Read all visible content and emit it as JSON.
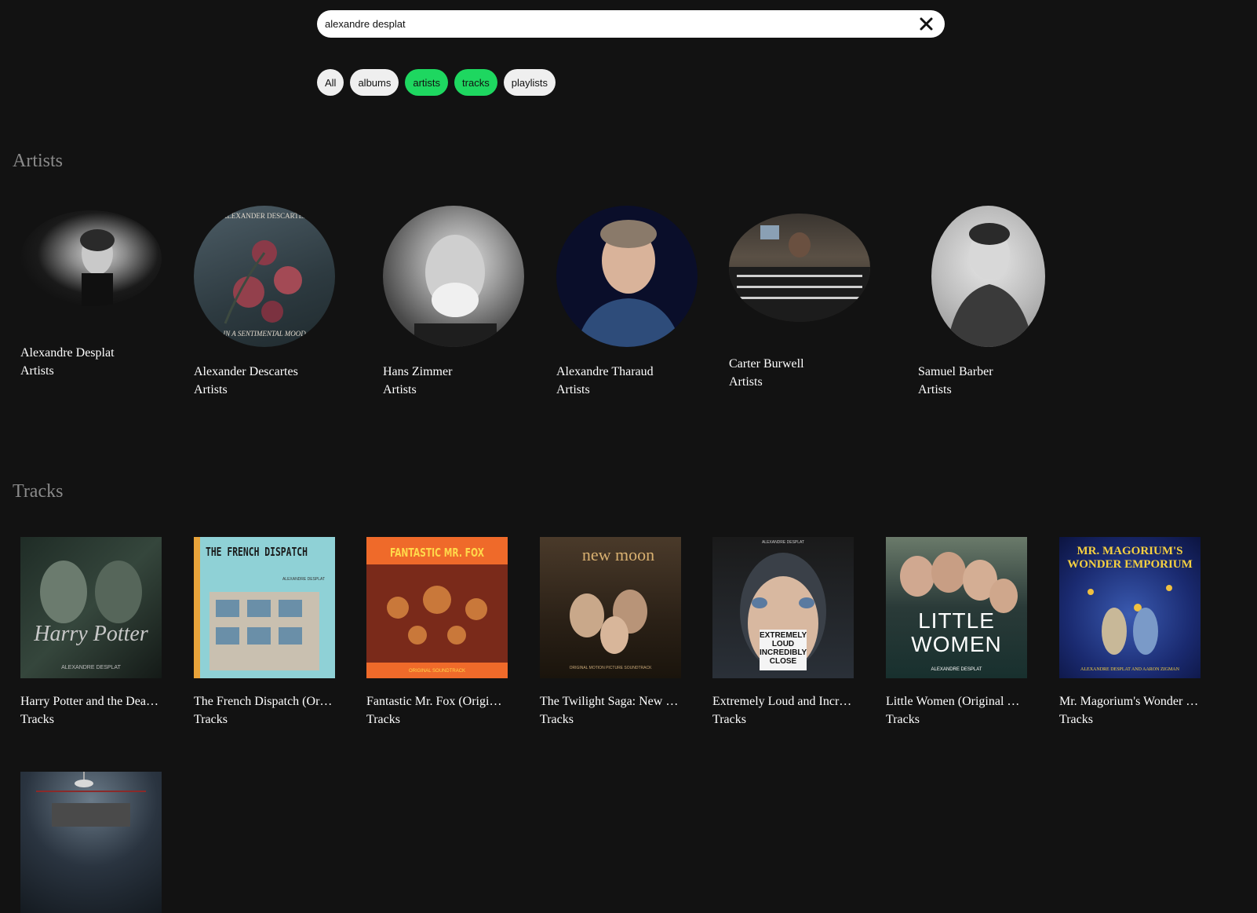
{
  "search": {
    "value": "alexandre desplat",
    "clear_icon": "close-icon"
  },
  "filters": [
    {
      "label": "All",
      "active": false
    },
    {
      "label": "albums",
      "active": false
    },
    {
      "label": "artists",
      "active": true
    },
    {
      "label": "tracks",
      "active": true
    },
    {
      "label": "playlists",
      "active": false
    }
  ],
  "colors": {
    "accent": "#1ed760",
    "background": "#121212",
    "section_title": "#8a8a8a"
  },
  "artists": {
    "title": "Artists",
    "items": [
      {
        "name": "Alexandre Desplat",
        "type": "Artists"
      },
      {
        "name": "Alexander Descartes",
        "type": "Artists",
        "art_text_top": "ALEXANDER DESCARTES",
        "art_text_bottom": "IN A SENTIMENTAL MOOD"
      },
      {
        "name": "Hans Zimmer",
        "type": "Artists"
      },
      {
        "name": "Alexandre Tharaud",
        "type": "Artists"
      },
      {
        "name": "Carter Burwell",
        "type": "Artists"
      },
      {
        "name": "Samuel Barber",
        "type": "Artists"
      }
    ]
  },
  "tracks": {
    "title": "Tracks",
    "items": [
      {
        "name": "Harry Potter and the Deathly Hallows",
        "type": "Tracks",
        "art_text": "Harry Potter",
        "art_sub": "ALEXANDRE DESPLAT"
      },
      {
        "name": "The French Dispatch (Original Soundtrack)",
        "type": "Tracks",
        "art_text": "THE FRENCH DISPATCH",
        "art_sub": "ALEXANDRE DESPLAT"
      },
      {
        "name": "Fantastic Mr. Fox (Original Soundtrack)",
        "type": "Tracks",
        "art_text": "FANTASTIC MR. FOX",
        "art_sub": "ORIGINAL SOUNDTRACK"
      },
      {
        "name": "The Twilight Saga: New Moon",
        "type": "Tracks",
        "art_text": "new moon",
        "art_sub": "ORIGINAL MOTION PICTURE SOUNDTRACK"
      },
      {
        "name": "Extremely Loud and Incredibly Close",
        "type": "Tracks",
        "art_text": "EXTREMELY LOUD INCREDIBLY CLOSE",
        "art_sub": "ALEXANDRE DESPLAT"
      },
      {
        "name": "Little Women (Original Motion Picture Soundtrack)",
        "type": "Tracks",
        "art_text": "LITTLE WOMEN",
        "art_sub": "ALEXANDRE DESPLAT"
      },
      {
        "name": "Mr. Magorium's Wonder Emporium",
        "type": "Tracks",
        "art_text": "MR. MAGORIUM'S WONDER EMPORIUM",
        "art_sub": "ALEXANDRE DESPLAT AND AARON ZIGMAN"
      },
      {
        "name": "",
        "type": "",
        "art_text": "",
        "art_sub": ""
      }
    ]
  }
}
